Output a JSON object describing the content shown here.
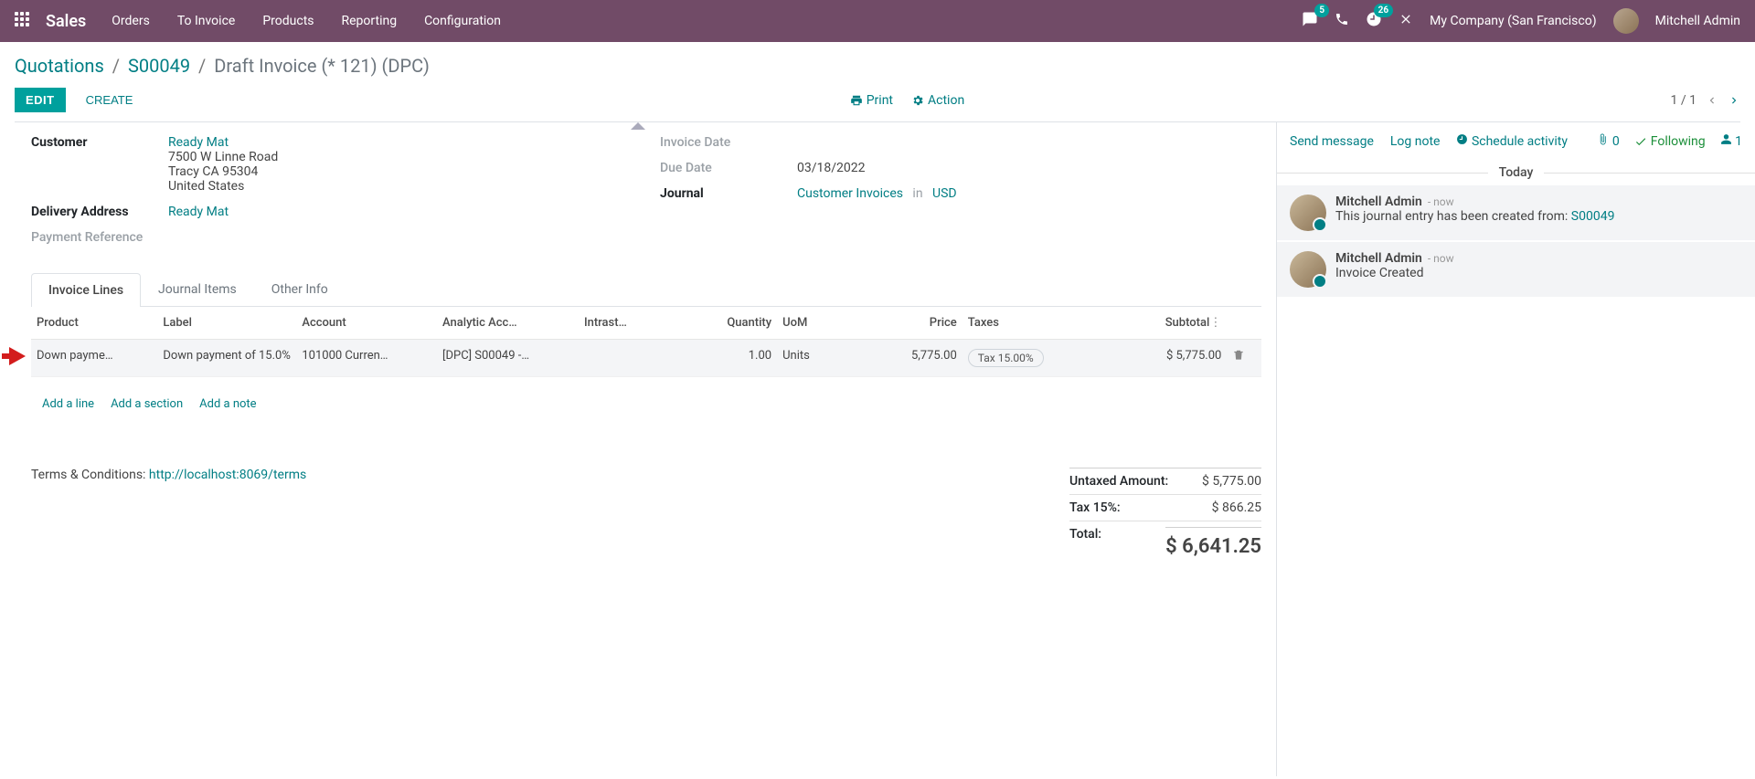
{
  "nav": {
    "brand": "Sales",
    "menu": [
      "Orders",
      "To Invoice",
      "Products",
      "Reporting",
      "Configuration"
    ],
    "msg_badge": "5",
    "activity_badge": "26",
    "company": "My Company (San Francisco)",
    "user": "Mitchell Admin"
  },
  "breadcrumb": {
    "a": "Quotations",
    "b": "S00049",
    "current": "Draft Invoice (* 121) (DPC)"
  },
  "toolbar": {
    "edit": "EDIT",
    "create": "CREATE",
    "print": "Print",
    "action": "Action",
    "pager": "1 / 1"
  },
  "form": {
    "customer_label": "Customer",
    "customer_name": "Ready Mat",
    "customer_addr1": "7500 W Linne Road",
    "customer_addr2": "Tracy CA 95304",
    "customer_addr3": "United States",
    "delivery_label": "Delivery Address",
    "delivery_value": "Ready Mat",
    "payref_label": "Payment Reference",
    "invdate_label": "Invoice Date",
    "duedate_label": "Due Date",
    "duedate_val": "03/18/2022",
    "journal_label": "Journal",
    "journal_val": "Customer Invoices",
    "journal_in": "in",
    "journal_currency": "USD"
  },
  "tabs": [
    "Invoice Lines",
    "Journal Items",
    "Other Info"
  ],
  "columns": {
    "product": "Product",
    "label": "Label",
    "account": "Account",
    "analytic": "Analytic Acc…",
    "intrastat": "Intrast…",
    "qty": "Quantity",
    "uom": "UoM",
    "price": "Price",
    "taxes": "Taxes",
    "subtotal": "Subtotal"
  },
  "line": {
    "product": "Down payme…",
    "label": "Down payment of 15.0%",
    "account": "101000 Curren…",
    "analytic": "[DPC] S00049 -…",
    "qty": "1.00",
    "uom": "Units",
    "price": "5,775.00",
    "tax": "Tax 15.00%",
    "subtotal": "$ 5,775.00"
  },
  "line_actions": {
    "add_line": "Add a line",
    "add_section": "Add a section",
    "add_note": "Add a note"
  },
  "terms": {
    "prefix": "Terms & Conditions: ",
    "link": "http://localhost:8069/terms"
  },
  "totals": {
    "untaxed_label": "Untaxed Amount:",
    "untaxed_val": "$ 5,775.00",
    "tax_label": "Tax 15%:",
    "tax_val": "$ 866.25",
    "total_label": "Total:",
    "total_val": "$ 6,641.25"
  },
  "chatter": {
    "send": "Send message",
    "log": "Log note",
    "schedule": "Schedule activity",
    "attach_n": "0",
    "following": "Following",
    "followers_n": "1",
    "today": "Today",
    "m1_author": "Mitchell Admin",
    "m1_time": "- now",
    "m1_body_a": "This journal entry has been created from: ",
    "m1_body_link": "S00049",
    "m2_author": "Mitchell Admin",
    "m2_time": "- now",
    "m2_body": "Invoice Created"
  }
}
